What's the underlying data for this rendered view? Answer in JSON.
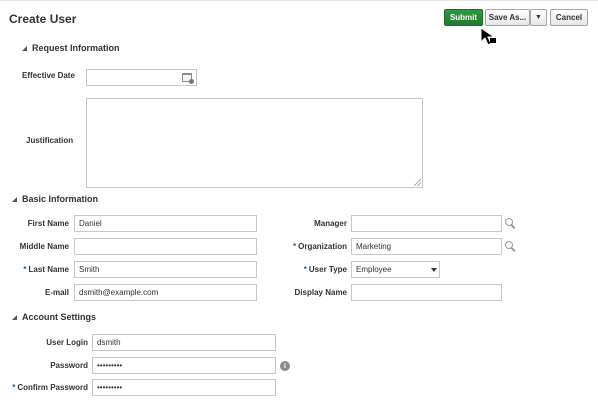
{
  "header": {
    "title": "Create User",
    "submit_label": "Submit",
    "save_as_label": "Save As...",
    "save_as_menu_glyph": "▼",
    "cancel_label": "Cancel"
  },
  "request_info": {
    "section_title": "Request Information",
    "effective_date_label": "Effective Date",
    "effective_date_value": "",
    "justification_label": "Justification",
    "justification_value": ""
  },
  "basic_info": {
    "section_title": "Basic Information",
    "first_name_label": "First Name",
    "first_name_value": "Daniel",
    "middle_name_label": "Middle Name",
    "middle_name_value": "",
    "last_name_label": "Last Name",
    "last_name_value": "Smith",
    "email_label": "E-mail",
    "email_value": "dsmith@example.com",
    "manager_label": "Manager",
    "manager_value": "",
    "organization_label": "Organization",
    "organization_value": "Marketing",
    "user_type_label": "User Type",
    "user_type_value": "Employee",
    "display_name_label": "Display Name",
    "display_name_value": ""
  },
  "account_settings": {
    "section_title": "Account Settings",
    "user_login_label": "User Login",
    "user_login_value": "dsmith",
    "password_label": "Password",
    "password_value": "•••••••••",
    "confirm_password_label": "Confirm Password",
    "confirm_password_value": "•••••••••"
  },
  "required_marker": "*",
  "icons": {
    "calendar": "calendar-icon",
    "search": "search-icon",
    "info": "info-icon",
    "info_glyph": "i"
  },
  "colors": {
    "submit_bg": "#2f9a3e",
    "required_marker": "#0067b8",
    "field_border": "#c7c7c7"
  }
}
